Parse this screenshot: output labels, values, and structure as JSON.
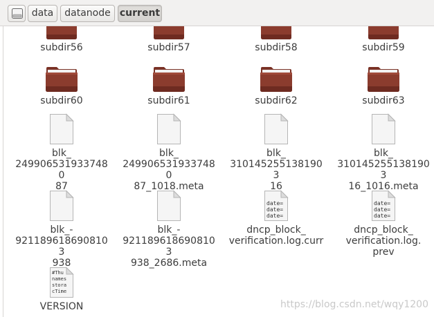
{
  "breadcrumb": {
    "items": [
      "data",
      "datanode",
      "current"
    ],
    "drive_icon": "drive-icon"
  },
  "files": {
    "folders_row1": [
      "subdir56",
      "subdir57",
      "subdir58",
      "subdir59"
    ],
    "folders_row2": [
      "subdir60",
      "subdir61",
      "subdir62",
      "subdir63"
    ],
    "files_row3": [
      "blk_\n2499065319337480\n87",
      "blk_\n2499065319337480\n87_1018.meta",
      "blk_\n3101452551381903\n16",
      "blk_\n3101452551381903\n16_1016.meta"
    ],
    "files_row4": [
      "blk_-\n9211896186908103\n938",
      "blk_-\n9211896186908103\n938_2686.meta",
      "dncp_block_\nverification.log.curr",
      "dncp_block_\nverification.log.\nprev"
    ],
    "files_row5": [
      "VERSION"
    ],
    "text_preview_dncp": "date=\ndate=\ndate=",
    "text_preview_version": "#Thu\nnames\nstora\ncTime"
  },
  "watermark": "https://blog.csdn.net/wqy1200",
  "colors": {
    "folder": "#8b3c2e",
    "folder_dark": "#6b2a20"
  }
}
